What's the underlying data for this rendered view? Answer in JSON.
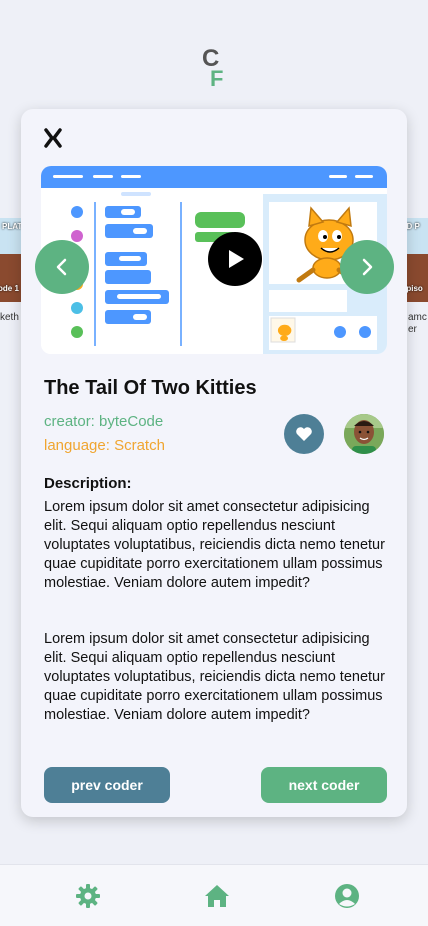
{
  "app": {
    "logo_letters": "CF"
  },
  "carousel": {
    "left_card_text": "ode 1",
    "left_card_top": "PLATF",
    "left_caption": "keth",
    "right_card_text": "Episo",
    "right_card_top": "2D P",
    "right_caption_line1": "amc",
    "right_caption_line2": "er"
  },
  "project": {
    "title": "The Tail Of Two Kitties",
    "creator": "creator: byteCode",
    "language": "language: Scratch",
    "description_heading": "Description:",
    "description_paragraph_1": "Lorem ipsum dolor sit amet consectetur adipisicing elit. Sequi aliquam optio repellendus nesciunt voluptates voluptatibus, reiciendis dicta nemo tenetur quae cupiditate porro exercitationem ullam possimus molestiae. Veniam dolore autem impedit?",
    "description_paragraph_2": "Lorem ipsum dolor sit amet consectetur adipisicing elit. Sequi aliquam optio repellendus nesciunt voluptates voluptatibus, reiciendis dicta nemo tenetur quae cupiditate porro exercitationem ullam possimus molestiae. Veniam dolore autem impedit?"
  },
  "buttons": {
    "prev": "prev coder",
    "next": "next coder"
  },
  "icons": {
    "close": "close-icon",
    "prev_arrow": "chevron-left-icon",
    "next_arrow": "chevron-right-icon",
    "play": "play-icon",
    "like": "heart-icon",
    "settings": "gear-icon",
    "home": "home-icon",
    "profile": "user-circle-icon"
  },
  "colors": {
    "accent_green": "#5db382",
    "accent_blue": "#4e7f96",
    "accent_orange": "#f0a530",
    "background": "#eef0f7"
  }
}
